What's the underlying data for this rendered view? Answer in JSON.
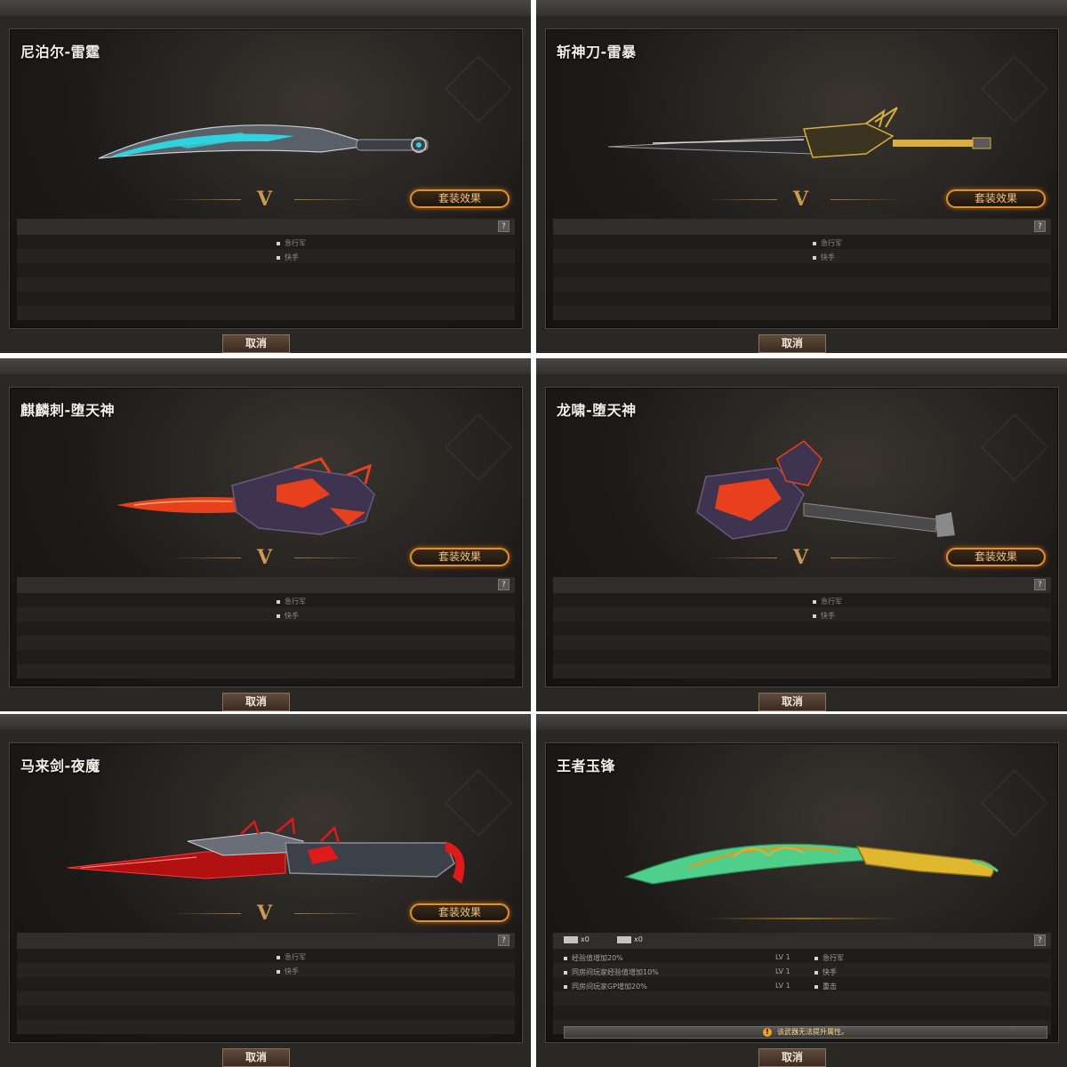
{
  "cards": [
    {
      "title": "尼泊尔-雷霆",
      "set_button": "套装效果",
      "help": "?",
      "items": [
        "急行军",
        "快手"
      ],
      "cancel": "取消",
      "weapon_colors": [
        "#2fd3e0",
        "#8a8f96"
      ]
    },
    {
      "title": "斩神刀-雷暴",
      "set_button": "套装效果",
      "help": "?",
      "items": [
        "急行军",
        "快手"
      ],
      "cancel": "取消",
      "weapon_colors": [
        "#d8b03a",
        "#5a5a5a"
      ]
    },
    {
      "title": "麒麟刺-堕天神",
      "set_button": "套装效果",
      "help": "?",
      "items": [
        "急行军",
        "快手"
      ],
      "cancel": "取消",
      "weapon_colors": [
        "#e8401c",
        "#4a3a5a"
      ]
    },
    {
      "title": "龙啸-堕天神",
      "set_button": "套装效果",
      "help": "?",
      "items": [
        "急行军",
        "快手"
      ],
      "cancel": "取消",
      "weapon_colors": [
        "#e8401c",
        "#4a3a5a"
      ]
    },
    {
      "title": "马来剑-夜魔",
      "set_button": "套装效果",
      "help": "?",
      "items": [
        "急行军",
        "快手"
      ],
      "cancel": "取消",
      "weapon_colors": [
        "#e01a1a",
        "#6a6e78"
      ]
    },
    {
      "title": "王者玉锋",
      "help": "?",
      "tags": [
        "x0",
        "x0"
      ],
      "stats": [
        {
          "label": "经验值增加20%",
          "lv": "LV 1",
          "perk": "急行军"
        },
        {
          "label": "同房间玩家经验值增加10%",
          "lv": "LV 1",
          "perk": "快手"
        },
        {
          "label": "同房间玩家GP增加20%",
          "lv": "LV 1",
          "perk": "重击"
        }
      ],
      "warning": "该武器无法提升属性。",
      "cancel": "取消",
      "weapon_colors": [
        "#4fd08a",
        "#e0b830"
      ]
    }
  ]
}
